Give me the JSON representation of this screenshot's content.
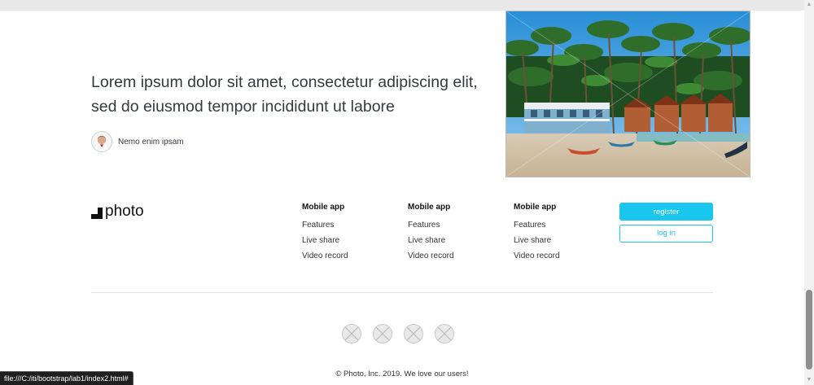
{
  "hero": {
    "quote": "Lorem ipsum dolor sit amet, consectetur adipiscing elit, sed do eiusmod tempor incididunt ut labore",
    "author_name": "Nemo enim ipsam"
  },
  "footer": {
    "logo_text": "photo",
    "columns": [
      {
        "title": "Mobile app",
        "links": [
          "Features",
          "Live share",
          "Video record"
        ]
      },
      {
        "title": "Mobile app",
        "links": [
          "Features",
          "Live share",
          "Video record"
        ]
      },
      {
        "title": "Mobile app",
        "links": [
          "Features",
          "Live share",
          "Video record"
        ]
      }
    ],
    "register_label": "register",
    "login_label": "log in",
    "social_icons": [
      "placeholder-icon",
      "placeholder-icon",
      "placeholder-icon",
      "placeholder-icon"
    ],
    "copyright": "© Photo, Inc. 2019. We love our users!"
  },
  "status_bar": {
    "url": "file:///C:/iti/bootstrap/lab1/index2.html#"
  },
  "colors": {
    "accent": "#18c6ee",
    "text": "#343a40"
  }
}
